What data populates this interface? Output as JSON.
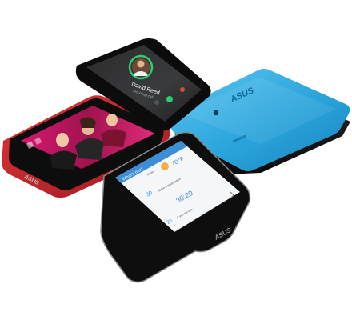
{
  "brand": {
    "logo_text": "ASUS"
  },
  "call_screen": {
    "caller_name": "David Reed",
    "status": "Incoming call",
    "accent_color": "#2ecc71"
  },
  "home_screen": {
    "header": "What's next",
    "date_label": "Today",
    "weather_temp": "70°F",
    "event_day": "30",
    "event_text": "Make a reservation",
    "clock_time": "30:20",
    "reminder_day": "25",
    "reminder_text": "If you are late",
    "accent_color": "#3b8fd6"
  },
  "devices": [
    {
      "name": "black-phone-call",
      "color": "#1b1b1b"
    },
    {
      "name": "red-tablet",
      "color": "#c8272c"
    },
    {
      "name": "blue-tablet-back",
      "color": "#29a9e0"
    },
    {
      "name": "black-tablet-home",
      "color": "#141414"
    }
  ]
}
